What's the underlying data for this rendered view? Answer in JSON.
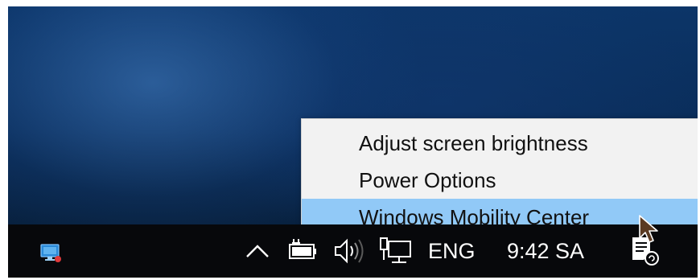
{
  "desktop": {
    "context_menu": {
      "items": [
        {
          "label": "Adjust screen brightness",
          "highlighted": false
        },
        {
          "label": "Power Options",
          "highlighted": false
        },
        {
          "label": "Windows Mobility Center",
          "highlighted": true
        }
      ]
    },
    "taskbar": {
      "app_icon": "screen-recorder-icon",
      "tray_icons": [
        "chevron-up-icon",
        "battery-icon",
        "volume-icon",
        "network-icon",
        "notification-icon"
      ],
      "language": "ENG",
      "clock": "9:42 SA"
    }
  },
  "colors": {
    "highlight": "#91c9f7",
    "taskbar": "#07080b",
    "menu_background": "#f2f2f2"
  }
}
